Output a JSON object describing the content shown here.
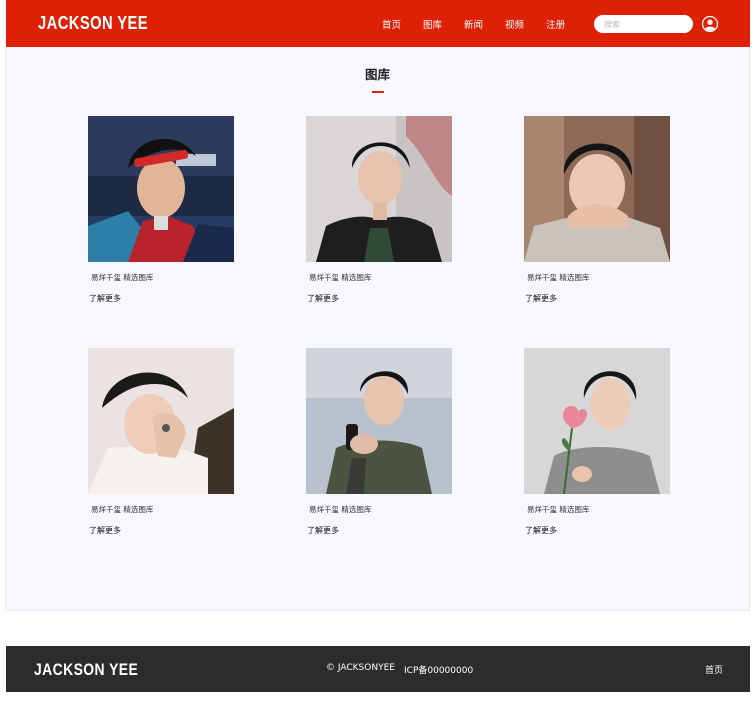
{
  "header": {
    "logo": "JACKSON YEE",
    "nav": [
      "首页",
      "图库",
      "新闻",
      "视频",
      "注册"
    ],
    "search_placeholder": "搜索"
  },
  "main": {
    "title": "图库",
    "cards": [
      {
        "caption": "易烊千玺 精选图库",
        "more": "了解更多"
      },
      {
        "caption": "易烊千玺 精选图库",
        "more": "了解更多"
      },
      {
        "caption": "易烊千玺 精选图库",
        "more": "了解更多"
      },
      {
        "caption": "易烊千玺 精选图库",
        "more": "了解更多"
      },
      {
        "caption": "易烊千玺 精选图库",
        "more": "了解更多"
      },
      {
        "caption": "易烊千玺 精选图库",
        "more": "了解更多"
      }
    ]
  },
  "footer": {
    "logo": "JACKSON YEE",
    "copyright": "© JACKSONYEE",
    "icp": "ICP备00000000",
    "home": "首页"
  },
  "colors": {
    "brand_red": "#dd2106",
    "page_bg": "#f7f7ff",
    "footer_bg": "#2c2c2c"
  }
}
